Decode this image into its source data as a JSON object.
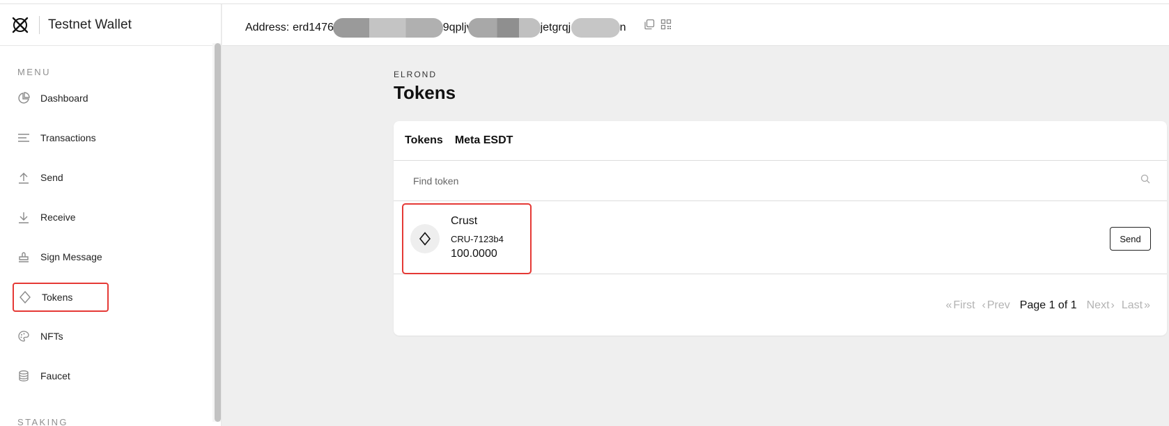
{
  "sidebar": {
    "brand_title": "Testnet Wallet",
    "menu_label": "MENU",
    "staking_label": "STAKING",
    "items": [
      {
        "label": "Dashboard",
        "icon": "pie-chart-icon"
      },
      {
        "label": "Transactions",
        "icon": "list-icon"
      },
      {
        "label": "Send",
        "icon": "upload-icon"
      },
      {
        "label": "Receive",
        "icon": "download-icon"
      },
      {
        "label": "Sign Message",
        "icon": "stamp-icon"
      },
      {
        "label": "Tokens",
        "icon": "diamond-icon"
      },
      {
        "label": "NFTs",
        "icon": "palette-icon"
      },
      {
        "label": "Faucet",
        "icon": "coins-icon"
      }
    ],
    "active_item": "Tokens"
  },
  "header": {
    "address_label": "Address:",
    "address_part1": "erd1476h",
    "address_part2": "9qpljv",
    "address_part3": "jetgrqjı",
    "address_part4": "n"
  },
  "main": {
    "eyebrow": "ELROND",
    "title": "Tokens",
    "tabs": [
      "Tokens",
      "Meta ESDT"
    ],
    "search_placeholder": "Find token",
    "tokens": [
      {
        "name": "Crust",
        "identifier": "CRU-7123b4",
        "balance": "100.0000",
        "action": "Send"
      }
    ],
    "pagination": {
      "first": "First",
      "prev": "Prev",
      "current": "Page 1 of 1",
      "next": "Next",
      "last": "Last"
    }
  },
  "colors": {
    "highlight": "#e53935",
    "background": "#efefef",
    "card": "#ffffff"
  }
}
